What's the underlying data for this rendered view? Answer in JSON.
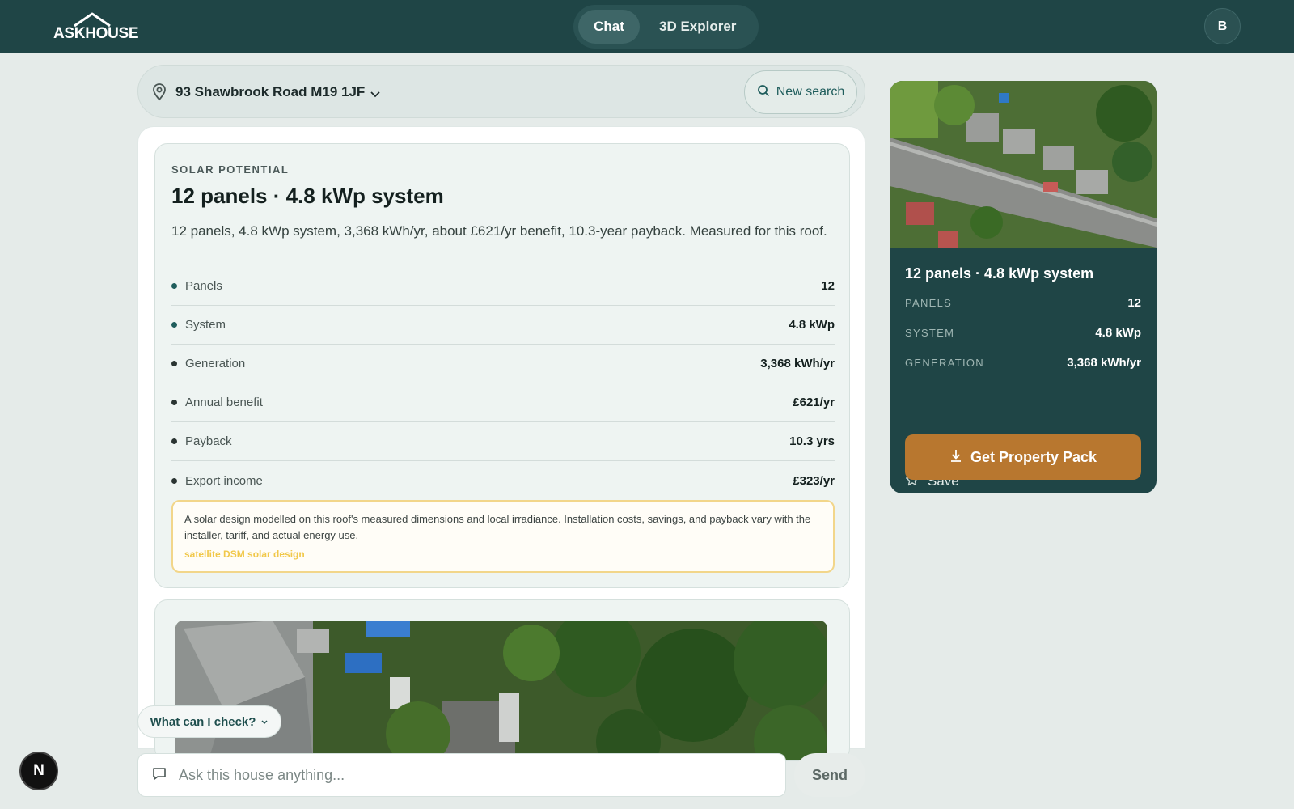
{
  "brand": {
    "logo_text": "ASKHOUSE"
  },
  "nav": {
    "tabs": [
      {
        "label": "Chat",
        "active": true
      },
      {
        "label": "3D Explorer",
        "active": false
      }
    ],
    "avatar_initial": "B"
  },
  "address": {
    "value": "93 Shawbrook Road M19 1JF",
    "new_search_label": "New search"
  },
  "solar_card": {
    "eyebrow": "SOLAR POTENTIAL",
    "title": "12 panels · 4.8 kWp system",
    "summary": "12 panels, 4.8 kWp system, 3,368 kWh/yr, about £621/yr benefit, 10.3-year payback. Measured for this roof.",
    "metrics": [
      {
        "label": "Panels",
        "value": "12"
      },
      {
        "label": "System",
        "value": "4.8 kWp"
      },
      {
        "label": "Generation",
        "value": "3,368 kWh/yr"
      },
      {
        "label": "Annual benefit",
        "value": "£621/yr"
      },
      {
        "label": "Payback",
        "value": "10.3 yrs"
      },
      {
        "label": "Export income",
        "value": "£323/yr"
      }
    ],
    "note": "A solar design modelled on this roof's measured dimensions and local irradiance. Installation costs, savings, and payback vary with the installer, tariff, and actual energy use.",
    "note_source": "satellite DSM solar design"
  },
  "chat": {
    "suggest_label": "What can I check?",
    "input_placeholder": "Ask this house anything...",
    "send_label": "Send"
  },
  "dev_badge": "N",
  "side_card": {
    "title": "12 panels · 4.8 kWp system",
    "stats": [
      {
        "label": "PANELS",
        "value": "12"
      },
      {
        "label": "SYSTEM",
        "value": "4.8 kWp"
      },
      {
        "label": "GENERATION",
        "value": "3,368 kWh/yr"
      }
    ],
    "save_label": "Save",
    "cta_label": "Get Property Pack"
  },
  "colors": {
    "header": "#1f4546",
    "accent": "#b8772f",
    "teal": "#1f5d5c",
    "note_border": "#f2d68a"
  },
  "icons": [
    "location-pin-icon",
    "chevron-down-icon",
    "search-icon",
    "chat-bubble-icon",
    "star-icon",
    "download-icon"
  ]
}
